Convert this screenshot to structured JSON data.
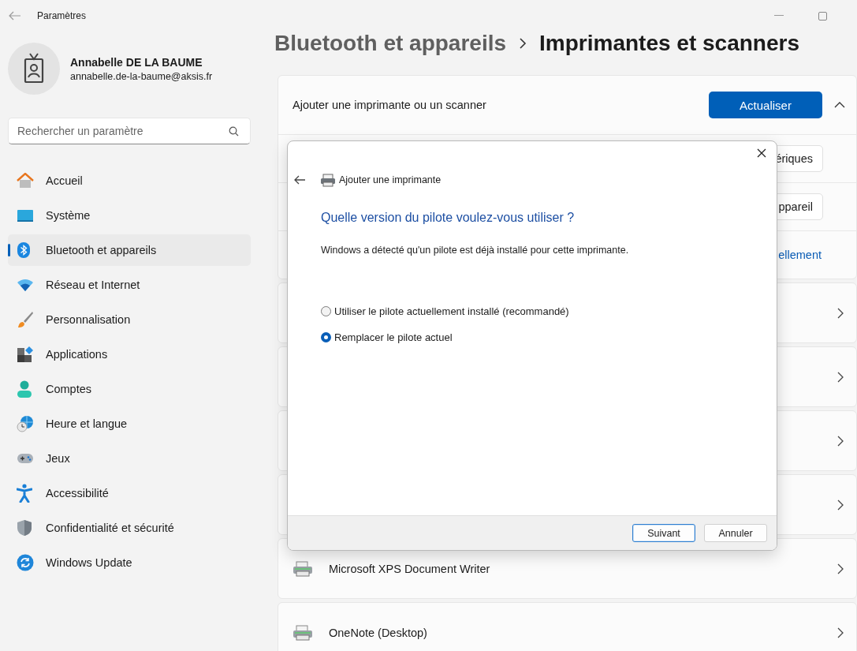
{
  "window": {
    "title": "Paramètres"
  },
  "account": {
    "name": "Annabelle DE LA BAUME",
    "email": "annabelle.de-la-baume@aksis.fr"
  },
  "search": {
    "placeholder": "Rechercher un paramètre"
  },
  "nav": [
    {
      "label": "Accueil",
      "selected": false
    },
    {
      "label": "Système",
      "selected": false
    },
    {
      "label": "Bluetooth et appareils",
      "selected": true
    },
    {
      "label": "Réseau et Internet",
      "selected": false
    },
    {
      "label": "Personnalisation",
      "selected": false
    },
    {
      "label": "Applications",
      "selected": false
    },
    {
      "label": "Comptes",
      "selected": false
    },
    {
      "label": "Heure et langue",
      "selected": false
    },
    {
      "label": "Jeux",
      "selected": false
    },
    {
      "label": "Accessibilité",
      "selected": false
    },
    {
      "label": "Confidentialité et sécurité",
      "selected": false
    },
    {
      "label": "Windows Update",
      "selected": false
    }
  ],
  "breadcrumb": [
    {
      "label": "Bluetooth et appareils",
      "current": false
    },
    {
      "label": "Imprimantes et scanners",
      "current": true
    }
  ],
  "add_section": {
    "label": "Ajouter une imprimante ou un scanner",
    "refresh_button": "Actualiser",
    "expanded": true,
    "rows": [
      {
        "kind": "button",
        "label": "ériques"
      },
      {
        "kind": "button",
        "label": "ppareil"
      },
      {
        "kind": "link",
        "label": "ellement"
      }
    ]
  },
  "printers": [
    {
      "kind": "covered"
    },
    {
      "kind": "covered"
    },
    {
      "kind": "covered"
    },
    {
      "kind": "covered"
    },
    {
      "kind": "printer",
      "name": "Microsoft XPS Document Writer"
    },
    {
      "kind": "printer",
      "name": "OneNote (Desktop)"
    }
  ],
  "dialog": {
    "title": "Ajouter une imprimante",
    "heading": "Quelle version du pilote voulez-vous utiliser ?",
    "description": "Windows a détecté qu'un pilote est déjà installé pour cette imprimante.",
    "options": [
      {
        "label": "Utiliser le pilote actuellement installé (recommandé)",
        "selected": false
      },
      {
        "label": "Remplacer le pilote actuel",
        "selected": true
      }
    ],
    "buttons": [
      {
        "label": "Suivant",
        "default": true
      },
      {
        "label": "Annuler",
        "default": false
      }
    ]
  }
}
